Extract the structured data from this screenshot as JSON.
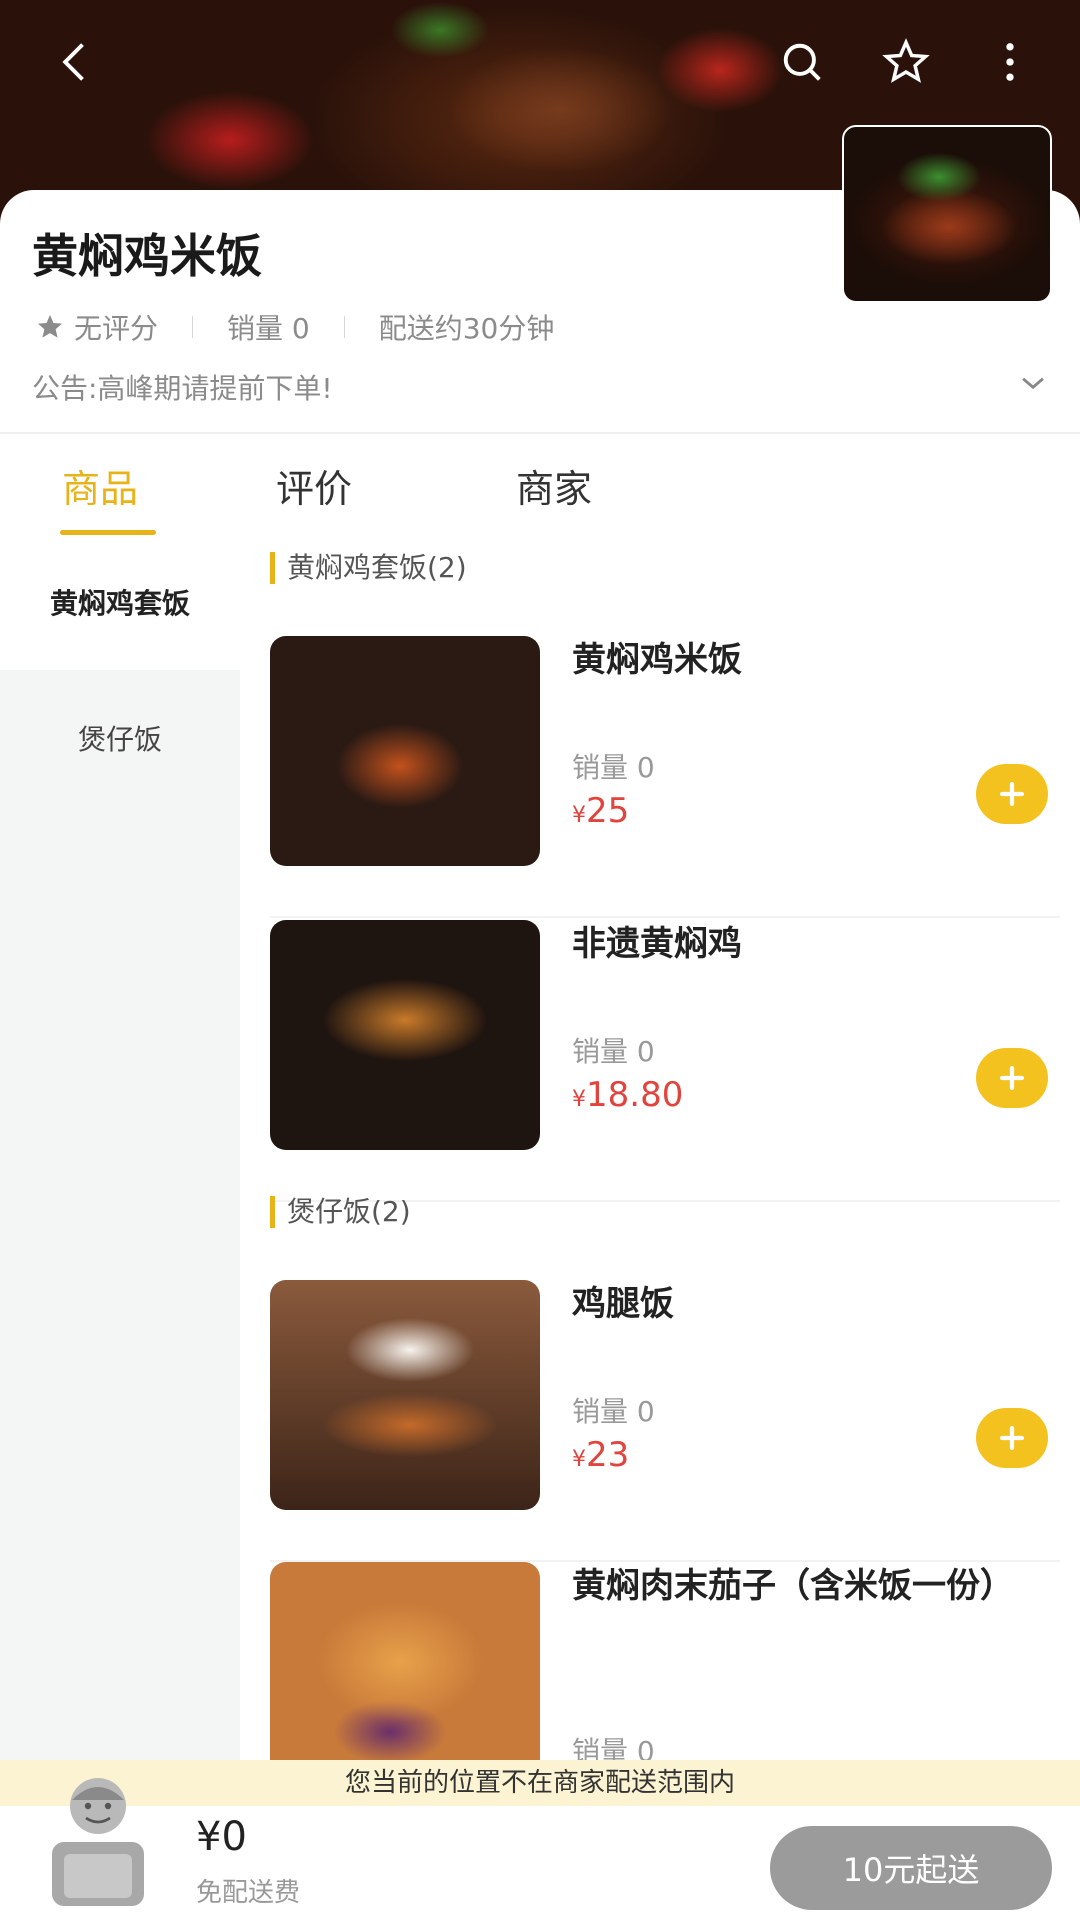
{
  "header": {
    "back_icon": "chevron-left-icon",
    "search_icon": "search-icon",
    "favorite_icon": "star-outline-icon",
    "more_icon": "more-vertical-icon"
  },
  "store": {
    "name": "黄焖鸡米饭",
    "rating": "无评分",
    "sales": "销量 0",
    "delivery_time": "配送约30分钟",
    "notice": "公告:高峰期请提前下单!"
  },
  "tabs": [
    {
      "label": "商品",
      "active": true
    },
    {
      "label": "评价",
      "active": false
    },
    {
      "label": "商家",
      "active": false
    }
  ],
  "categories": [
    {
      "label": "黄焖鸡套饭",
      "active": true
    },
    {
      "label": "煲仔饭",
      "active": false
    }
  ],
  "sections": [
    {
      "title": "黄焖鸡套饭(2)",
      "items": [
        {
          "name": "黄焖鸡米饭",
          "sales": "销量 0",
          "currency": "¥",
          "price": "25"
        },
        {
          "name": "非遗黄焖鸡",
          "sales": "销量 0",
          "currency": "¥",
          "price": "18.80"
        }
      ]
    },
    {
      "title": "煲仔饭(2)",
      "items": [
        {
          "name": "鸡腿饭",
          "sales": "销量 0",
          "currency": "¥",
          "price": "23"
        },
        {
          "name": "黄焖肉末茄子（含米饭一份）",
          "sales": "销量 0",
          "currency": "¥",
          "price": ""
        }
      ]
    }
  ],
  "cart": {
    "warning": "您当前的位置不在商家配送范围内",
    "total": "¥0",
    "delivery_fee": "免配送费",
    "min_order_button": "10元起送"
  },
  "colors": {
    "accent": "#e8b318",
    "add_button": "#f3c21f",
    "price": "#e0443c",
    "disabled_button": "#9b9b9b",
    "warning_bg": "#fbf3d2"
  }
}
